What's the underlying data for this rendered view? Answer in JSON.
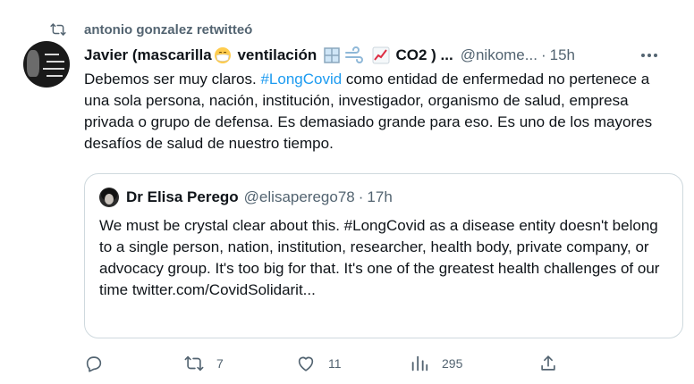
{
  "retweet_context": {
    "text": "antonio gonzalez retwitteó",
    "icon": "retweet-icon"
  },
  "author": {
    "name_part1": "Javier (mascarilla",
    "name_part2": "ventilación",
    "name_part3": "CO2 ) ...",
    "handle": "@nikome...",
    "separator": "·",
    "time": "15h"
  },
  "tweet": {
    "text_before": "Debemos ser muy claros.  ",
    "hashtag": "#LongCovid",
    "text_after": " como entidad de enfermedad no pertenece a una sola persona, nación, institución, investigador, organismo de salud, empresa privada o grupo de defensa.  Es demasiado grande para eso.  Es uno de los mayores desafíos de salud de nuestro tiempo."
  },
  "quoted": {
    "name": "Dr Elisa Perego",
    "handle": "@elisaperego78",
    "separator": "·",
    "time": "17h",
    "text": "We must be crystal clear about this. #LongCovid as a disease entity doesn't belong to a single person, nation, institution, researcher, health body, private company, or advocacy group. It's too big for that. It's one of the greatest health challenges of our time twitter.com/CovidSolidarit..."
  },
  "actions": {
    "replies": "",
    "retweets": "7",
    "likes": "11",
    "views": "295"
  },
  "colors": {
    "accent": "#1d9bf0",
    "secondary_text": "#536471",
    "border": "#cfd9de"
  }
}
